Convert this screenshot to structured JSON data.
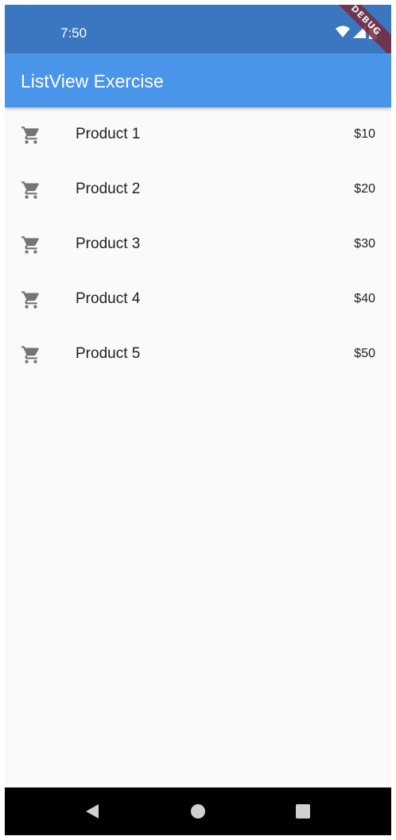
{
  "status_bar": {
    "time": "7:50",
    "icons": [
      "wifi-icon",
      "signal-icon",
      "battery-icon"
    ],
    "debug_label": "DEBUG"
  },
  "app_bar": {
    "title": "ListView Exercise",
    "color": "#4895ea"
  },
  "products": [
    {
      "icon": "shopping-cart-icon",
      "name": "Product 1",
      "price": "$10"
    },
    {
      "icon": "shopping-cart-icon",
      "name": "Product 2",
      "price": "$20"
    },
    {
      "icon": "shopping-cart-icon",
      "name": "Product 3",
      "price": "$30"
    },
    {
      "icon": "shopping-cart-icon",
      "name": "Product 4",
      "price": "$40"
    },
    {
      "icon": "shopping-cart-icon",
      "name": "Product 5",
      "price": "$50"
    }
  ],
  "nav_bar": {
    "buttons": [
      "back-icon",
      "home-icon",
      "recents-icon"
    ]
  }
}
